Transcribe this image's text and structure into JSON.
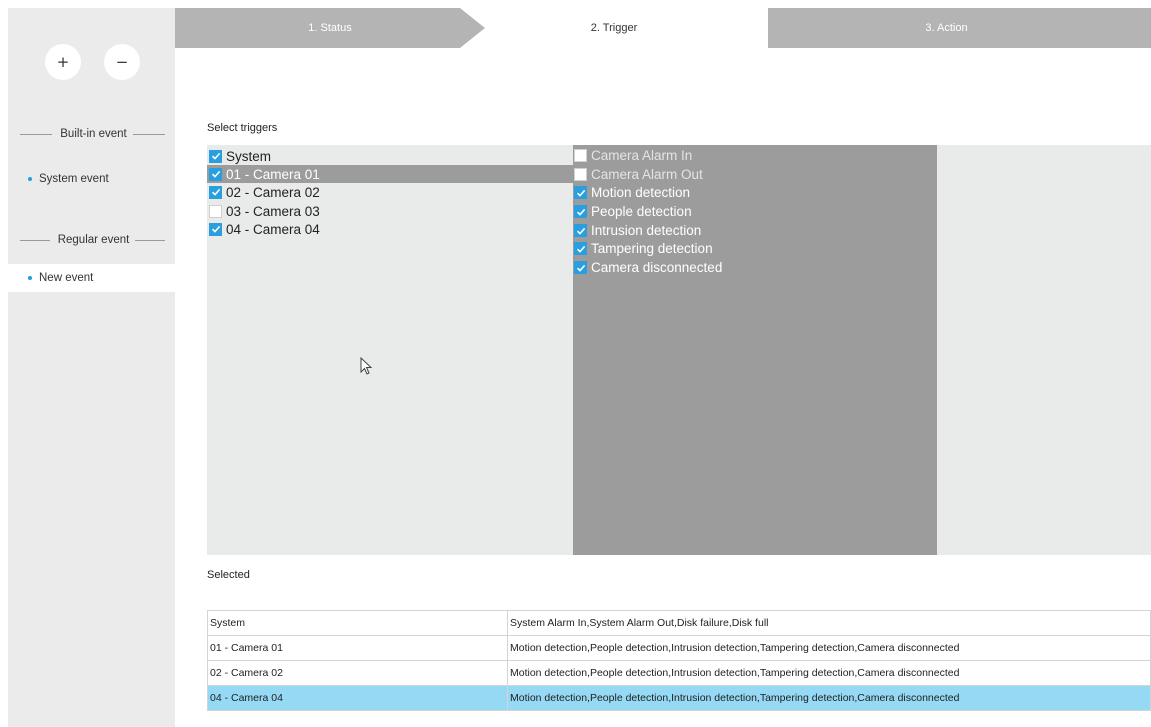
{
  "sidebar": {
    "add_label": "+",
    "remove_label": "−",
    "builtin_heading": "Built-in event",
    "builtin_items": [
      {
        "label": "System event"
      }
    ],
    "regular_heading": "Regular event",
    "regular_items": [
      {
        "label": "New event"
      }
    ]
  },
  "steps": [
    {
      "label": "1. Status",
      "state": "inactive"
    },
    {
      "label": "2. Trigger",
      "state": "active"
    },
    {
      "label": "3. Action",
      "state": "inactive"
    }
  ],
  "triggers": {
    "heading": "Select triggers",
    "sources": [
      {
        "label": "System",
        "checked": true
      },
      {
        "label": "01 - Camera 01",
        "checked": true,
        "selected": true
      },
      {
        "label": "02 - Camera 02",
        "checked": true
      },
      {
        "label": "03 - Camera 03",
        "checked": false
      },
      {
        "label": "04 - Camera 04",
        "checked": true
      }
    ],
    "events": [
      {
        "label": "Camera Alarm In",
        "checked": false,
        "enabled": false
      },
      {
        "label": "Camera Alarm Out",
        "checked": false,
        "enabled": false
      },
      {
        "label": "Motion detection",
        "checked": true,
        "enabled": true
      },
      {
        "label": "People detection",
        "checked": true,
        "enabled": true
      },
      {
        "label": "Intrusion detection",
        "checked": true,
        "enabled": true
      },
      {
        "label": "Tampering detection",
        "checked": true,
        "enabled": true
      },
      {
        "label": "Camera disconnected",
        "checked": true,
        "enabled": true
      }
    ]
  },
  "selected": {
    "heading": "Selected",
    "rows": [
      {
        "source": "System",
        "events": "System Alarm In,System Alarm Out,Disk failure,Disk full"
      },
      {
        "source": "01 - Camera 01",
        "events": "Motion detection,People detection,Intrusion detection,Tampering detection,Camera disconnected"
      },
      {
        "source": "02 - Camera 02",
        "events": "Motion detection,People detection,Intrusion detection,Tampering detection,Camera disconnected"
      },
      {
        "source": "04 - Camera 04",
        "events": "Motion detection,People detection,Intrusion detection,Tampering detection,Camera disconnected",
        "highlighted": true
      }
    ]
  },
  "colors": {
    "accent": "#2a9fe0",
    "highlight_row": "#96d9f4",
    "step_inactive": "#b4b4b4",
    "panel_dark": "#9c9c9c",
    "panel_light": "#e9eaea"
  }
}
